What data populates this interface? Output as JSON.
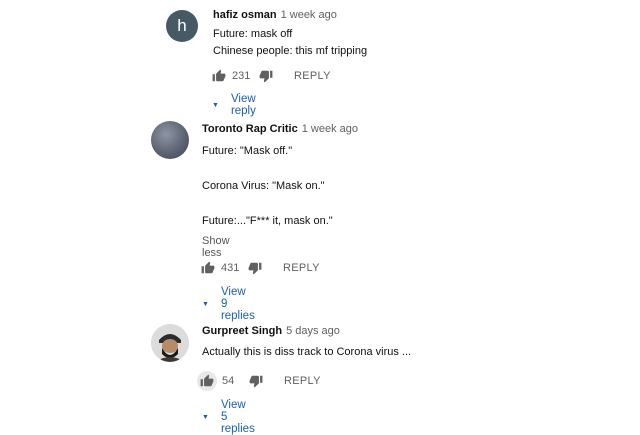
{
  "comments": [
    {
      "avatar_letter": "h",
      "author": "hafiz osman",
      "time": "1 week ago",
      "lines": [
        "Future: mask off",
        "Chinese people: this mf tripping"
      ],
      "likes": "231",
      "reply_label": "REPLY",
      "view_replies": "View reply"
    },
    {
      "author": "Toronto Rap Critic",
      "time": "1 week ago",
      "lines": [
        "Future: \"Mask off.\"",
        "Corona Virus: \"Mask on.\"",
        "Future:...\"F*** it, mask on.\""
      ],
      "show_less": "Show less",
      "likes": "431",
      "reply_label": "REPLY",
      "view_replies": "View 9 replies"
    },
    {
      "author": "Gurpreet Singh",
      "time": "5 days ago",
      "lines": [
        "Actually this is diss track to Corona virus ..."
      ],
      "likes": "54",
      "reply_label": "REPLY",
      "view_replies": "View 5 replies"
    }
  ],
  "colors": {
    "link": "#1a5fb4",
    "meta": "#606060"
  },
  "icons": [
    "thumb-up-icon",
    "thumb-down-icon",
    "caret-down-icon"
  ]
}
